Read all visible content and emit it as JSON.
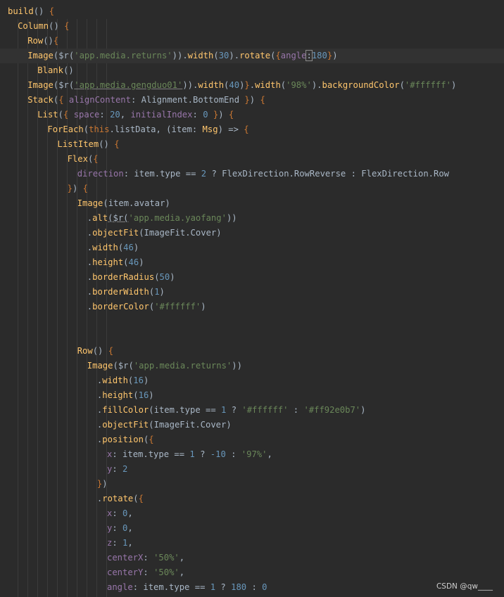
{
  "watermark": "CSDN @qw____",
  "code_lines": [
    [
      [
        "fn",
        "build"
      ],
      [
        "plain",
        "() "
      ],
      [
        "kw",
        "{"
      ]
    ],
    [
      [
        "fn",
        "Column"
      ],
      [
        "plain",
        "() "
      ],
      [
        "kw",
        "{"
      ]
    ],
    [
      [
        "fn",
        "Row"
      ],
      [
        "plain",
        "()"
      ],
      [
        "kw",
        "{"
      ]
    ],
    [
      [
        "fn",
        "Image"
      ],
      [
        "plain",
        "($r("
      ],
      [
        "str",
        "'app.media.returns'"
      ],
      [
        "plain",
        "))."
      ],
      [
        "fn",
        "width"
      ],
      [
        "plain",
        "("
      ],
      [
        "num",
        "30"
      ],
      [
        "plain",
        ")."
      ],
      [
        "fn",
        "rotate"
      ],
      [
        "plain",
        "("
      ],
      [
        "kw",
        "{"
      ],
      [
        "prop",
        "angle"
      ],
      [
        "plain",
        ":"
      ],
      [
        "num",
        "180"
      ],
      [
        "kw",
        "}"
      ],
      [
        "plain",
        ")"
      ]
    ],
    [
      [
        "fn",
        "Blank"
      ],
      [
        "plain",
        "()"
      ]
    ],
    [
      [
        "fn",
        "Image"
      ],
      [
        "plain",
        "($r("
      ],
      [
        "str",
        "'app.media.gengduo01'"
      ],
      [
        "plain",
        "))."
      ],
      [
        "fn",
        "width"
      ],
      [
        "plain",
        "("
      ],
      [
        "num",
        "40"
      ],
      [
        "plain",
        ")"
      ],
      [
        "kw",
        "}"
      ],
      [
        "plain",
        "."
      ],
      [
        "fn",
        "width"
      ],
      [
        "plain",
        "("
      ],
      [
        "str",
        "'98%'"
      ],
      [
        "plain",
        ")."
      ],
      [
        "fn",
        "backgroundColor"
      ],
      [
        "plain",
        "("
      ],
      [
        "str",
        "'#ffffff'"
      ],
      [
        "plain",
        ")"
      ]
    ],
    [
      [
        "fn",
        "Stack"
      ],
      [
        "plain",
        "("
      ],
      [
        "kw",
        "{"
      ],
      [
        "plain",
        " "
      ],
      [
        "prop",
        "alignContent"
      ],
      [
        "plain",
        ": Alignment.BottomEnd "
      ],
      [
        "kw",
        "}"
      ],
      [
        "plain",
        ") "
      ],
      [
        "kw",
        "{"
      ]
    ],
    [
      [
        "fn",
        "List"
      ],
      [
        "plain",
        "("
      ],
      [
        "kw",
        "{"
      ],
      [
        "plain",
        " "
      ],
      [
        "prop",
        "space"
      ],
      [
        "plain",
        ": "
      ],
      [
        "num",
        "20"
      ],
      [
        "plain",
        ", "
      ],
      [
        "prop",
        "initialIndex"
      ],
      [
        "plain",
        ": "
      ],
      [
        "num",
        "0"
      ],
      [
        "plain",
        " "
      ],
      [
        "kw",
        "}"
      ],
      [
        "plain",
        ") "
      ],
      [
        "kw",
        "{"
      ]
    ],
    [
      [
        "fn",
        "ForEach"
      ],
      [
        "plain",
        "("
      ],
      [
        "kw",
        "this"
      ],
      [
        "plain",
        ".listData, (item: "
      ],
      [
        "type",
        "Msg"
      ],
      [
        "plain",
        ") => "
      ],
      [
        "kw",
        "{"
      ]
    ],
    [
      [
        "fn",
        "ListItem"
      ],
      [
        "plain",
        "() "
      ],
      [
        "kw",
        "{"
      ]
    ],
    [
      [
        "fn",
        "Flex"
      ],
      [
        "plain",
        "("
      ],
      [
        "kw",
        "{"
      ]
    ],
    [
      [
        "prop",
        "direction"
      ],
      [
        "plain",
        ": item.type == "
      ],
      [
        "num",
        "2"
      ],
      [
        "plain",
        " ? FlexDirection.RowReverse : FlexDirection.Row"
      ]
    ],
    [
      [
        "kw",
        "}"
      ],
      [
        "plain",
        ") "
      ],
      [
        "kw",
        "{"
      ]
    ],
    [
      [
        "fn",
        "Image"
      ],
      [
        "plain",
        "(item.avatar)"
      ]
    ],
    [
      [
        "plain",
        "."
      ],
      [
        "fn",
        "alt"
      ],
      [
        "plain",
        "($r("
      ],
      [
        "str",
        "'app.media.yaofang'"
      ],
      [
        "plain",
        "))"
      ]
    ],
    [
      [
        "plain",
        "."
      ],
      [
        "fn",
        "objectFit"
      ],
      [
        "plain",
        "(ImageFit.Cover)"
      ]
    ],
    [
      [
        "plain",
        "."
      ],
      [
        "fn",
        "width"
      ],
      [
        "plain",
        "("
      ],
      [
        "num",
        "46"
      ],
      [
        "plain",
        ")"
      ]
    ],
    [
      [
        "plain",
        "."
      ],
      [
        "fn",
        "height"
      ],
      [
        "plain",
        "("
      ],
      [
        "num",
        "46"
      ],
      [
        "plain",
        ")"
      ]
    ],
    [
      [
        "plain",
        "."
      ],
      [
        "fn",
        "borderRadius"
      ],
      [
        "plain",
        "("
      ],
      [
        "num",
        "50"
      ],
      [
        "plain",
        ")"
      ]
    ],
    [
      [
        "plain",
        "."
      ],
      [
        "fn",
        "borderWidth"
      ],
      [
        "plain",
        "("
      ],
      [
        "num",
        "1"
      ],
      [
        "plain",
        ")"
      ]
    ],
    [
      [
        "plain",
        "."
      ],
      [
        "fn",
        "borderColor"
      ],
      [
        "plain",
        "("
      ],
      [
        "str",
        "'#ffffff'"
      ],
      [
        "plain",
        ")"
      ]
    ],
    [],
    [],
    [
      [
        "fn",
        "Row"
      ],
      [
        "plain",
        "() "
      ],
      [
        "kw",
        "{"
      ]
    ],
    [
      [
        "fn",
        "Image"
      ],
      [
        "plain",
        "($r("
      ],
      [
        "str",
        "'app.media.returns'"
      ],
      [
        "plain",
        "))"
      ]
    ],
    [
      [
        "plain",
        "."
      ],
      [
        "fn",
        "width"
      ],
      [
        "plain",
        "("
      ],
      [
        "num",
        "16"
      ],
      [
        "plain",
        ")"
      ]
    ],
    [
      [
        "plain",
        "."
      ],
      [
        "fn",
        "height"
      ],
      [
        "plain",
        "("
      ],
      [
        "num",
        "16"
      ],
      [
        "plain",
        ")"
      ]
    ],
    [
      [
        "plain",
        "."
      ],
      [
        "fn",
        "fillColor"
      ],
      [
        "plain",
        "(item.type == "
      ],
      [
        "num",
        "1"
      ],
      [
        "plain",
        " ? "
      ],
      [
        "str",
        "'#ffffff'"
      ],
      [
        "plain",
        " : "
      ],
      [
        "str",
        "'#ff92e0b7'"
      ],
      [
        "plain",
        ")"
      ]
    ],
    [
      [
        "plain",
        "."
      ],
      [
        "fn",
        "objectFit"
      ],
      [
        "plain",
        "(ImageFit.Cover)"
      ]
    ],
    [
      [
        "plain",
        "."
      ],
      [
        "fn",
        "position"
      ],
      [
        "plain",
        "("
      ],
      [
        "kw",
        "{"
      ]
    ],
    [
      [
        "prop",
        "x"
      ],
      [
        "plain",
        ": item.type == "
      ],
      [
        "num",
        "1"
      ],
      [
        "plain",
        " ? "
      ],
      [
        "num",
        "-10"
      ],
      [
        "plain",
        " : "
      ],
      [
        "str",
        "'97%'"
      ],
      [
        "plain",
        ","
      ]
    ],
    [
      [
        "prop",
        "y"
      ],
      [
        "plain",
        ": "
      ],
      [
        "num",
        "2"
      ]
    ],
    [
      [
        "kw",
        "}"
      ],
      [
        "plain",
        ")"
      ]
    ],
    [
      [
        "plain",
        "."
      ],
      [
        "fn",
        "rotate"
      ],
      [
        "plain",
        "("
      ],
      [
        "kw",
        "{"
      ]
    ],
    [
      [
        "prop",
        "x"
      ],
      [
        "plain",
        ": "
      ],
      [
        "num",
        "0"
      ],
      [
        "plain",
        ","
      ]
    ],
    [
      [
        "prop",
        "y"
      ],
      [
        "plain",
        ": "
      ],
      [
        "num",
        "0"
      ],
      [
        "plain",
        ","
      ]
    ],
    [
      [
        "prop",
        "z"
      ],
      [
        "plain",
        ": "
      ],
      [
        "num",
        "1"
      ],
      [
        "plain",
        ","
      ]
    ],
    [
      [
        "prop",
        "centerX"
      ],
      [
        "plain",
        ": "
      ],
      [
        "str",
        "'50%'"
      ],
      [
        "plain",
        ","
      ]
    ],
    [
      [
        "prop",
        "centerY"
      ],
      [
        "plain",
        ": "
      ],
      [
        "str",
        "'50%'"
      ],
      [
        "plain",
        ","
      ]
    ],
    [
      [
        "prop",
        "angle"
      ],
      [
        "plain",
        ": item.type == "
      ],
      [
        "num",
        "1"
      ],
      [
        "plain",
        " ? "
      ],
      [
        "num",
        "180"
      ],
      [
        "plain",
        " : "
      ],
      [
        "num",
        "0"
      ]
    ]
  ]
}
